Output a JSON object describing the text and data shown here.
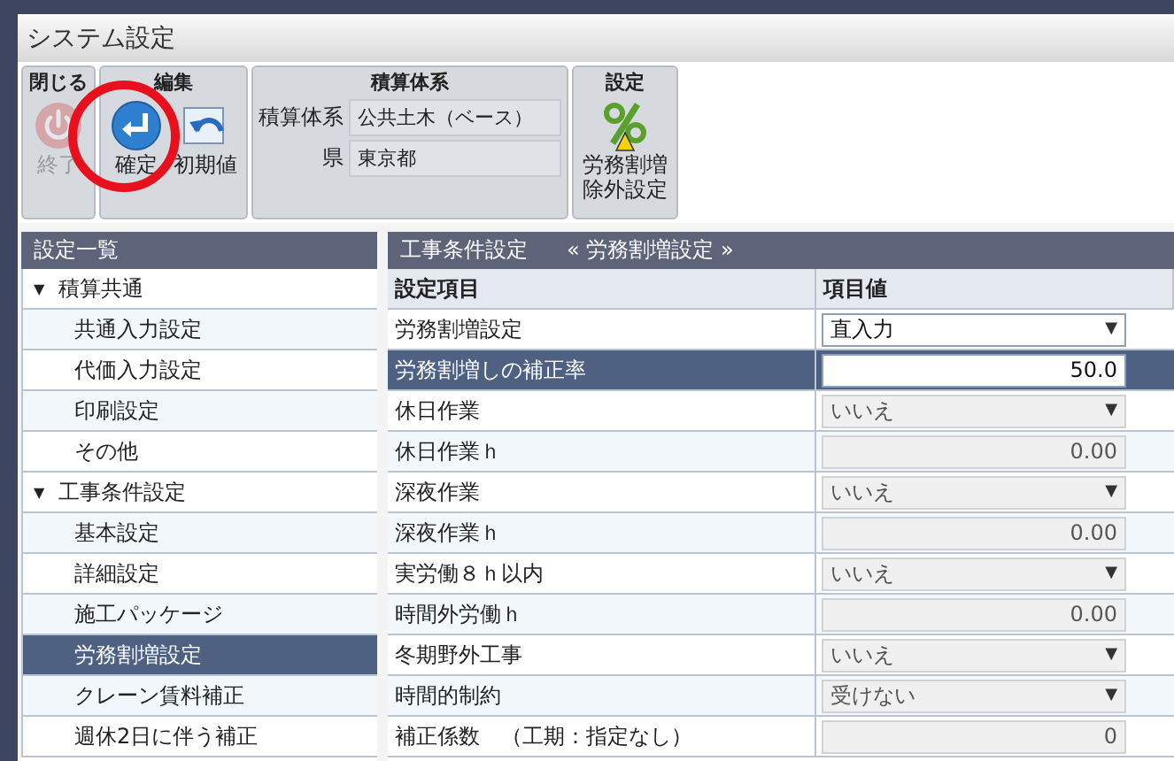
{
  "window": {
    "title": "システム設定"
  },
  "toolbar": [
    {
      "title": "閉じる",
      "kind": "buttons",
      "buttons": [
        {
          "lines": [
            "終了"
          ],
          "disabled": true
        }
      ]
    },
    {
      "title": "編集",
      "kind": "buttons",
      "buttons": [
        {
          "lines": [
            "確定"
          ],
          "disabled": false
        },
        {
          "lines": [
            "初期値"
          ],
          "disabled": false
        }
      ]
    },
    {
      "title": "積算体系",
      "kind": "fields",
      "fields": [
        {
          "label": "積算体系",
          "value": "公共土木（ベース）"
        },
        {
          "label": "県",
          "value": "東京都"
        }
      ]
    },
    {
      "title": "設定",
      "kind": "buttons",
      "buttons": [
        {
          "lines": [
            "労務割増",
            "除外設定"
          ],
          "disabled": false
        }
      ]
    }
  ],
  "sidebar": {
    "title": "設定一覧",
    "items": [
      {
        "label": "積算共通",
        "expanded": true,
        "selected": false,
        "children": [
          {
            "label": "共通入力設定",
            "selected": false
          },
          {
            "label": "代価入力設定",
            "selected": false
          },
          {
            "label": "印刷設定",
            "selected": false
          },
          {
            "label": "その他",
            "selected": false
          }
        ]
      },
      {
        "label": "工事条件設定",
        "expanded": true,
        "selected": false,
        "children": [
          {
            "label": "基本設定",
            "selected": false
          },
          {
            "label": "詳細設定",
            "selected": false
          },
          {
            "label": "施工パッケージ",
            "selected": false
          },
          {
            "label": "労務割増設定",
            "selected": true
          },
          {
            "label": "クレーン賃料補正",
            "selected": false
          },
          {
            "label": "週休2日に伴う補正",
            "selected": false
          }
        ]
      }
    ]
  },
  "panel": {
    "title": "工事条件設定",
    "subtitle": "« 労務割増設定 »",
    "columns": [
      "設定項目",
      "項目値"
    ],
    "rows": [
      {
        "label": "労務割増設定",
        "kind": "select",
        "value": "直入力",
        "disabled": false,
        "selected": false
      },
      {
        "label": "労務割増しの補正率",
        "kind": "number",
        "value": "50.0",
        "disabled": false,
        "selected": true
      },
      {
        "label": "休日作業",
        "kind": "select",
        "value": "いいえ",
        "disabled": true,
        "selected": false
      },
      {
        "label": "休日作業ｈ",
        "kind": "number",
        "value": "0.00",
        "disabled": true,
        "selected": false
      },
      {
        "label": "深夜作業",
        "kind": "select",
        "value": "いいえ",
        "disabled": true,
        "selected": false
      },
      {
        "label": "深夜作業ｈ",
        "kind": "number",
        "value": "0.00",
        "disabled": true,
        "selected": false
      },
      {
        "label": "実労働８ｈ以内",
        "kind": "select",
        "value": "いいえ",
        "disabled": true,
        "selected": false
      },
      {
        "label": "時間外労働ｈ",
        "kind": "number",
        "value": "0.00",
        "disabled": true,
        "selected": false
      },
      {
        "label": "冬期野外工事",
        "kind": "select",
        "value": "いいえ",
        "disabled": true,
        "selected": false
      },
      {
        "label": "時間的制約",
        "kind": "select",
        "value": "受けない",
        "disabled": true,
        "selected": false
      },
      {
        "label": "補正係数　（工期：指定なし）",
        "kind": "number",
        "value": "0",
        "disabled": true,
        "selected": false
      }
    ]
  },
  "caret": "▼",
  "tree_caret": "▼"
}
